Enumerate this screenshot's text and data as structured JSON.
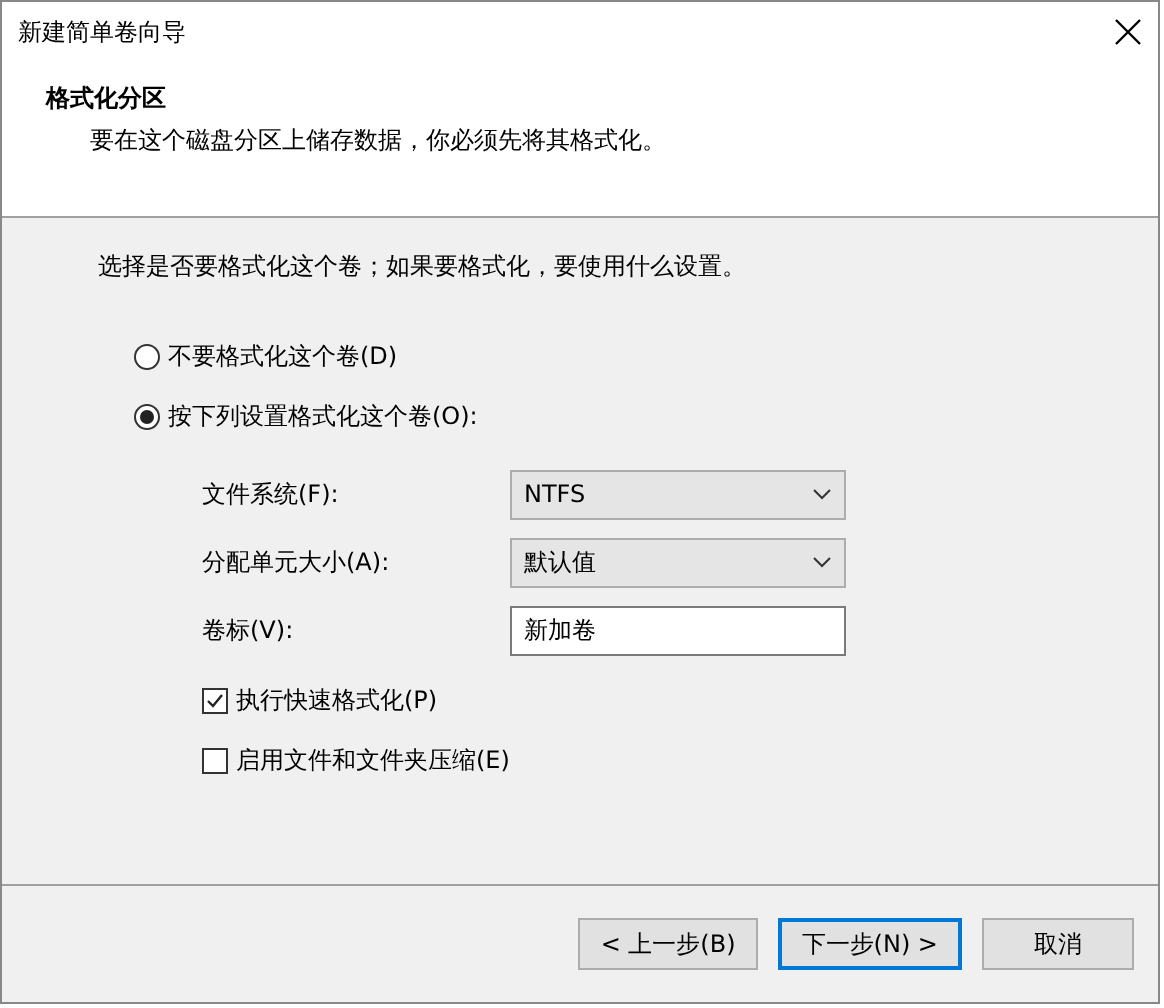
{
  "window": {
    "title": "新建简单卷向导"
  },
  "header": {
    "title": "格式化分区",
    "subtitle": "要在这个磁盘分区上储存数据，你必须先将其格式化。"
  },
  "instruction": "选择是否要格式化这个卷；如果要格式化，要使用什么设置。",
  "options": [
    {
      "label": "不要格式化这个卷(D)",
      "selected": false
    },
    {
      "label": "按下列设置格式化这个卷(O):",
      "selected": true
    }
  ],
  "settings": [
    {
      "kind": "dropdown",
      "label": "文件系统(F):",
      "value": "NTFS"
    },
    {
      "kind": "dropdown",
      "label": "分配单元大小(A):",
      "value": "默认值"
    },
    {
      "kind": "text",
      "label": "卷标(V):",
      "value": "新加卷"
    }
  ],
  "checkboxes": [
    {
      "label": "执行快速格式化(P)",
      "checked": true
    },
    {
      "label": "启用文件和文件夹压缩(E)",
      "checked": false
    }
  ],
  "buttons": [
    {
      "label": "< 上一步(B)",
      "default": false
    },
    {
      "label": "下一步(N) >",
      "default": true
    },
    {
      "label": "取消",
      "default": false
    }
  ]
}
